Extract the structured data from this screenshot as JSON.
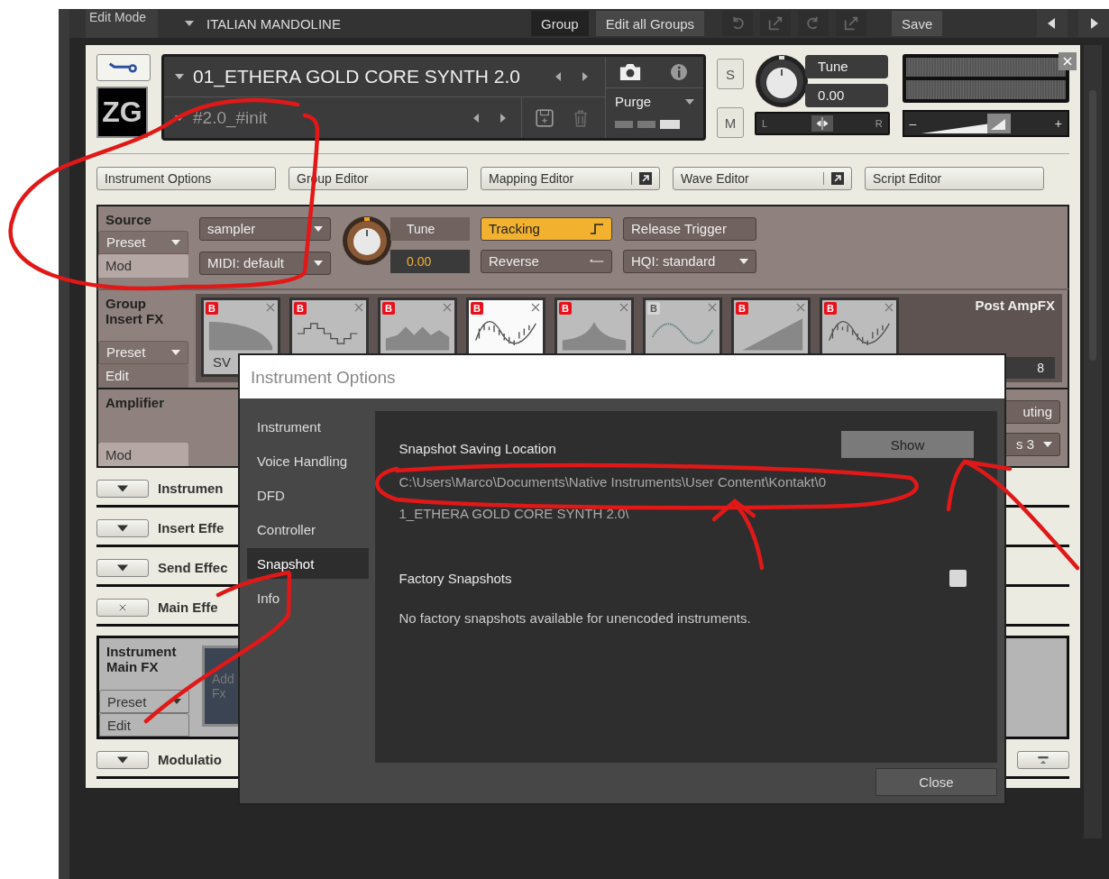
{
  "top_bar": {
    "mode_label": "Edit Mode",
    "instrument_menu": "ITALIAN MANDOLINE",
    "buttons": [
      {
        "label": "Group",
        "selected": true
      },
      {
        "label": "Edit all Groups",
        "selected": false
      }
    ],
    "save": "Save"
  },
  "instrument": {
    "logo": "ZG",
    "name": "01_ETHERA GOLD CORE SYNTH 2.0",
    "snapshot": "#2.0_#init",
    "purge": "Purge",
    "solo": "S",
    "mute": "M",
    "tune_label": "Tune",
    "tune_value": "0.00",
    "pan_left": "L",
    "pan_right": "R",
    "vol_minus": "–",
    "vol_plus": "+",
    "pan": {
      "level": 0.5
    }
  },
  "editor_tabs": [
    {
      "label": "Instrument Options",
      "popout": false
    },
    {
      "label": "Group Editor",
      "popout": false
    },
    {
      "label": "Mapping Editor",
      "popout": true
    },
    {
      "label": "Wave Editor",
      "popout": true
    },
    {
      "label": "Script Editor",
      "popout": false
    }
  ],
  "source": {
    "title": "Source",
    "preset": "Preset",
    "mod": "Mod",
    "dropdowns": [
      "sampler",
      "MIDI: default"
    ],
    "tune_label": "Tune",
    "tune_value": "0.00",
    "buttons": [
      {
        "label": "Tracking",
        "kind": "toggle",
        "on": true
      },
      {
        "label": "Release Trigger",
        "kind": "toggle",
        "on": false
      },
      {
        "label": "Reverse",
        "kind": "toggle",
        "on": false
      },
      {
        "label": "HQI: standard",
        "kind": "dropdown"
      }
    ]
  },
  "group_insert_fx": {
    "title": "Group Insert FX",
    "preset": "Preset",
    "edit": "Edit",
    "first_slot_label": "SV",
    "post_title": "Post AmpFX",
    "post_value": "8",
    "slots": [
      {
        "kind": "lowpass",
        "badge": "B",
        "bypass_on": true,
        "highlighted": false
      },
      {
        "kind": "stairs",
        "badge": "B",
        "bypass_on": true,
        "highlighted": false
      },
      {
        "kind": "peaks",
        "badge": "B",
        "bypass_on": true,
        "highlighted": false
      },
      {
        "kind": "dense-wave",
        "badge": "B",
        "bypass_on": true,
        "highlighted": true
      },
      {
        "kind": "peak",
        "badge": "B",
        "bypass_on": true,
        "highlighted": false
      },
      {
        "kind": "wave",
        "badge": "B",
        "bypass_on": false,
        "highlighted": false
      },
      {
        "kind": "ramp",
        "badge": "B",
        "bypass_on": true,
        "highlighted": false
      },
      {
        "kind": "dense-wave",
        "badge": "B",
        "bypass_on": true,
        "highlighted": false
      }
    ]
  },
  "amplifier": {
    "title": "Amplifier",
    "mod": "Mod",
    "routing": "uting",
    "channel": "s 3"
  },
  "collapsed_sections": [
    {
      "label": "Instrumen",
      "kind": "expand"
    },
    {
      "label": "Insert Effe",
      "kind": "expand"
    },
    {
      "label": "Send Effec",
      "kind": "expand"
    },
    {
      "label": "Main Effe",
      "kind": "remove"
    }
  ],
  "main_fx": {
    "title": "Instrument Main FX",
    "preset": "Preset",
    "edit": "Edit",
    "add_slot": [
      "Add",
      "Fx"
    ]
  },
  "modulation": {
    "label": "Modulatio"
  },
  "dialog": {
    "title": "Instrument Options",
    "nav": [
      {
        "label": "Instrument",
        "selected": false
      },
      {
        "label": "Voice Handling",
        "selected": false
      },
      {
        "label": "DFD",
        "selected": false
      },
      {
        "label": "Controller",
        "selected": false
      },
      {
        "label": "Snapshot",
        "selected": true
      },
      {
        "label": "Info",
        "selected": false
      }
    ],
    "heading": "Snapshot Saving Location",
    "show": "Show",
    "path": [
      "C:\\Users\\Marco\\Documents\\Native Instruments\\User Content\\Kontakt\\0",
      "1_ETHERA GOLD CORE SYNTH 2.0\\"
    ],
    "factory_label": "Factory Snapshots",
    "factory_checked": false,
    "factory_note": "No factory snapshots available for unencoded instruments.",
    "close": "Close"
  }
}
